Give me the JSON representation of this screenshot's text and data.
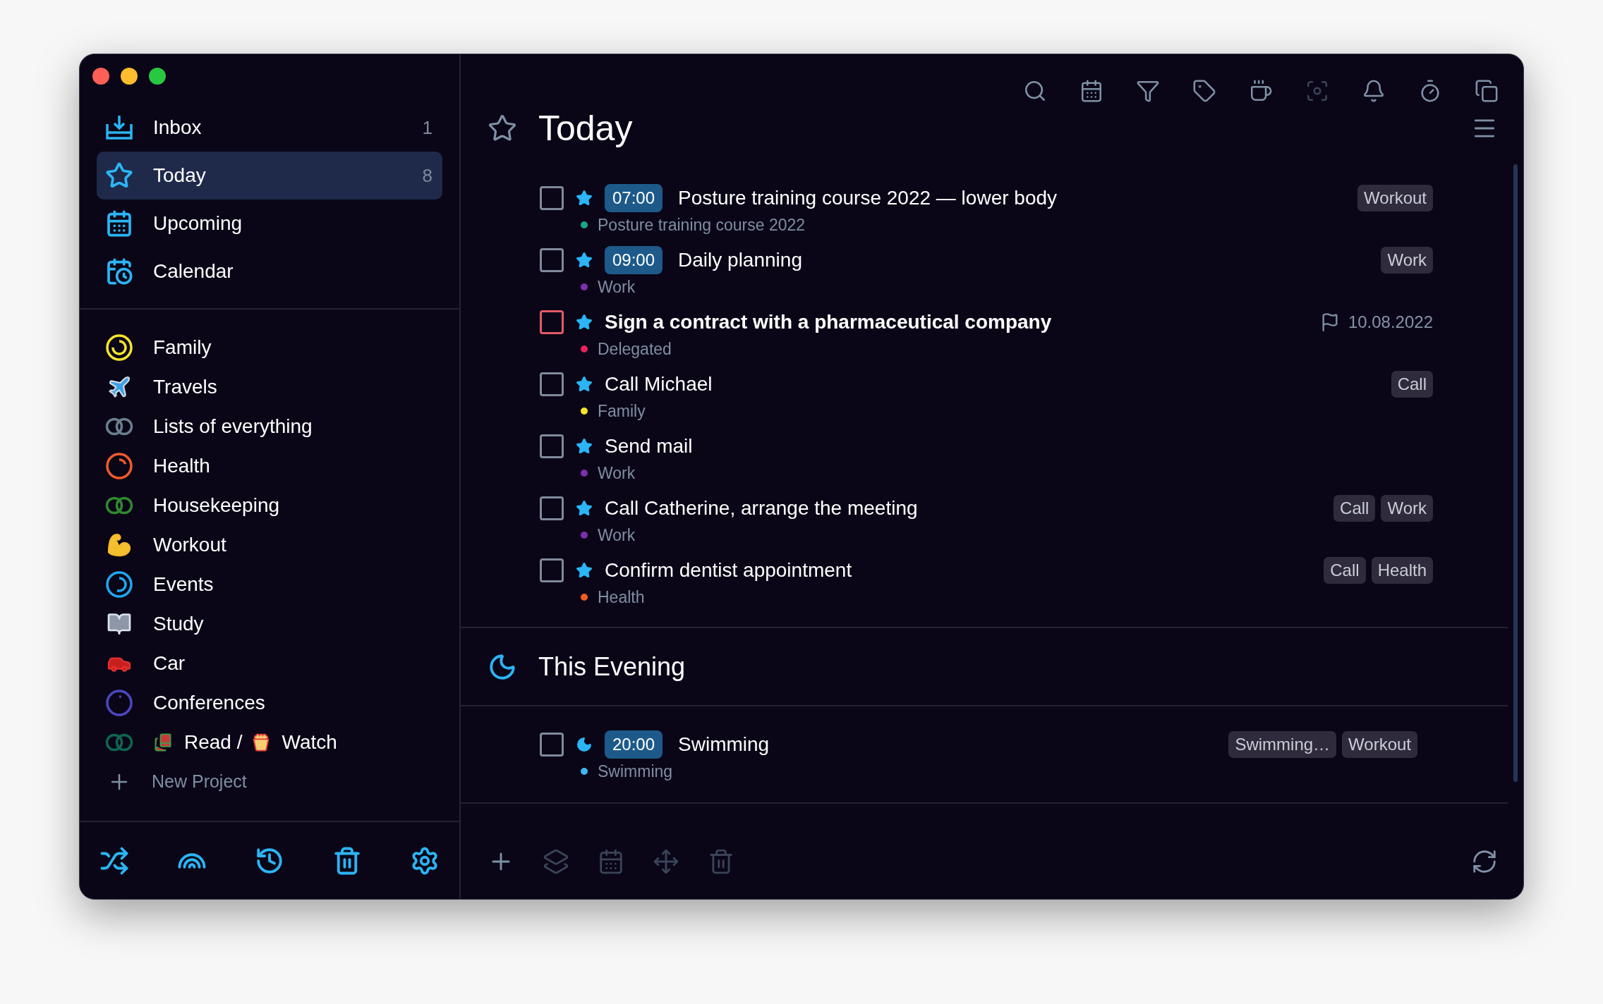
{
  "sidebar": {
    "nav": [
      {
        "label": "Inbox",
        "count": "1",
        "selected": false,
        "kind": "inbox"
      },
      {
        "label": "Today",
        "count": "8",
        "selected": true,
        "kind": "today"
      },
      {
        "label": "Upcoming",
        "selected": false,
        "kind": "upcoming"
      },
      {
        "label": "Calendar",
        "selected": false,
        "kind": "calendar"
      }
    ],
    "projects": [
      {
        "label": "Family",
        "kind": "ring",
        "color": "#f5e52a",
        "level": 0.75
      },
      {
        "label": "Travels",
        "kind": "plane"
      },
      {
        "label": "Lists of everything",
        "kind": "double-ring",
        "color": "#6b7f8f"
      },
      {
        "label": "Health",
        "kind": "ring",
        "color": "#f25a2a",
        "level": 0.2
      },
      {
        "label": "Housekeeping",
        "kind": "double-ring",
        "color": "#2f8a2f"
      },
      {
        "label": "Workout",
        "kind": "arm"
      },
      {
        "label": "Events",
        "kind": "ring",
        "color": "#1ea8f0",
        "level": 0.55
      },
      {
        "label": "Study",
        "kind": "book"
      },
      {
        "label": "Car",
        "kind": "car"
      },
      {
        "label": "Conferences",
        "kind": "ring",
        "color": "#4a48c0",
        "level": 0.05
      },
      {
        "label_parts": [
          "Read /",
          "Watch"
        ],
        "kind": "double-ring",
        "color": "#0f6650"
      }
    ],
    "new_project": "New Project"
  },
  "main": {
    "title": "Today",
    "sections": [
      {
        "kind": "today",
        "tasks": [
          {
            "time": "07:00",
            "title": "Posture training course 2022 — lower body",
            "project": "Posture training course 2022",
            "color": "#1aa88a",
            "tags": [
              "Workout"
            ],
            "checked": false,
            "high_priority": false
          },
          {
            "time": "09:00",
            "title": "Daily planning",
            "project": "Work",
            "color": "#7b2fb0",
            "tags": [
              "Work"
            ],
            "checked": false,
            "high_priority": false
          },
          {
            "title": "Sign a contract with a pharmaceutical company",
            "project": "Delegated",
            "color": "#e8225a",
            "deadline": "10.08.2022",
            "checked": false,
            "high_priority": true
          },
          {
            "title": "Call Michael",
            "project": "Family",
            "color": "#f5e52a",
            "tags": [
              "Call"
            ],
            "checked": false,
            "high_priority": false
          },
          {
            "title": "Send mail",
            "project": "Work",
            "color": "#7b2fb0",
            "checked": false,
            "high_priority": false
          },
          {
            "title": "Call Catherine, arrange the meeting",
            "project": "Work",
            "color": "#7b2fb0",
            "tags": [
              "Call",
              "Work"
            ],
            "checked": false,
            "high_priority": false
          },
          {
            "title": "Confirm dentist appointment",
            "project": "Health",
            "color": "#f25a22",
            "tags": [
              "Call",
              "Health"
            ],
            "checked": false,
            "high_priority": false
          }
        ]
      },
      {
        "kind": "evening",
        "title": "This Evening",
        "tasks": [
          {
            "time": "20:00",
            "title": "Swimming",
            "project": "Swimming",
            "color": "#3cb8f0",
            "tags": [
              "Swimming…",
              "Workout"
            ],
            "checked": false,
            "high_priority": false
          }
        ]
      }
    ]
  }
}
